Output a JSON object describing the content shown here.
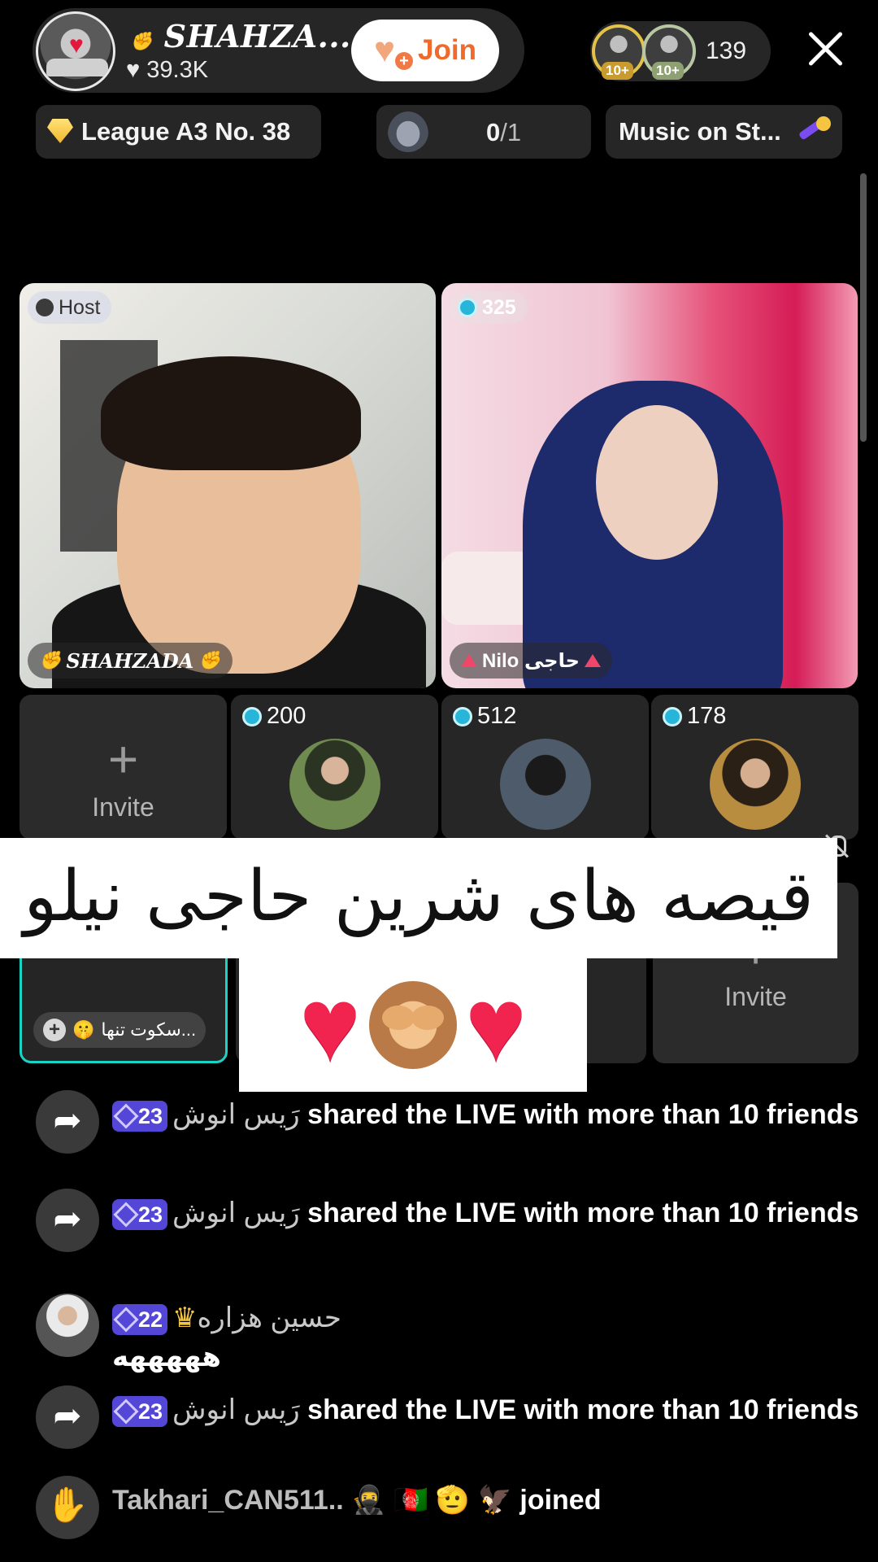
{
  "header": {
    "host_name": "SHAHZA...",
    "host_likes": "39.3K",
    "join_label": "Join",
    "viewer_badges": [
      "10+",
      "10+"
    ],
    "viewer_count": "139"
  },
  "chips": {
    "league": "League A3 No. 38",
    "battle_score": "0",
    "battle_total": "/1",
    "music": "Music on St..."
  },
  "tiles": {
    "host_tag": "Host",
    "host_name": "SHAHZADA",
    "guest_score": "325",
    "guest_name": "Nilo حاجی"
  },
  "small_tiles": {
    "invite_label": "Invite",
    "scores": [
      "200",
      "512",
      "178"
    ]
  },
  "row3": {
    "user_name": "سکوت تنها...",
    "invite_label": "Invite"
  },
  "overlay": {
    "caption": "قیصه های شرین حاجی نیلو"
  },
  "chat": [
    {
      "level": "23",
      "user": "رَیس انوش",
      "text": "shared the LIVE with more than 10 friends"
    },
    {
      "level": "23",
      "user": "رَیس انوش",
      "text": "shared the LIVE with more than 10 friends"
    },
    {
      "level": "22",
      "user": "حسین هزاره",
      "text": "هههههه"
    },
    {
      "level": "23",
      "user": "رَیس انوش",
      "text": "shared the LIVE with more than 10 friends"
    }
  ],
  "join_event": {
    "user": "Takhari_CAN511..",
    "text": "joined"
  },
  "colors": {
    "accent_orange": "#f06a2c",
    "level_badge": "#5446d6",
    "selected_border": "#19d3c7"
  }
}
